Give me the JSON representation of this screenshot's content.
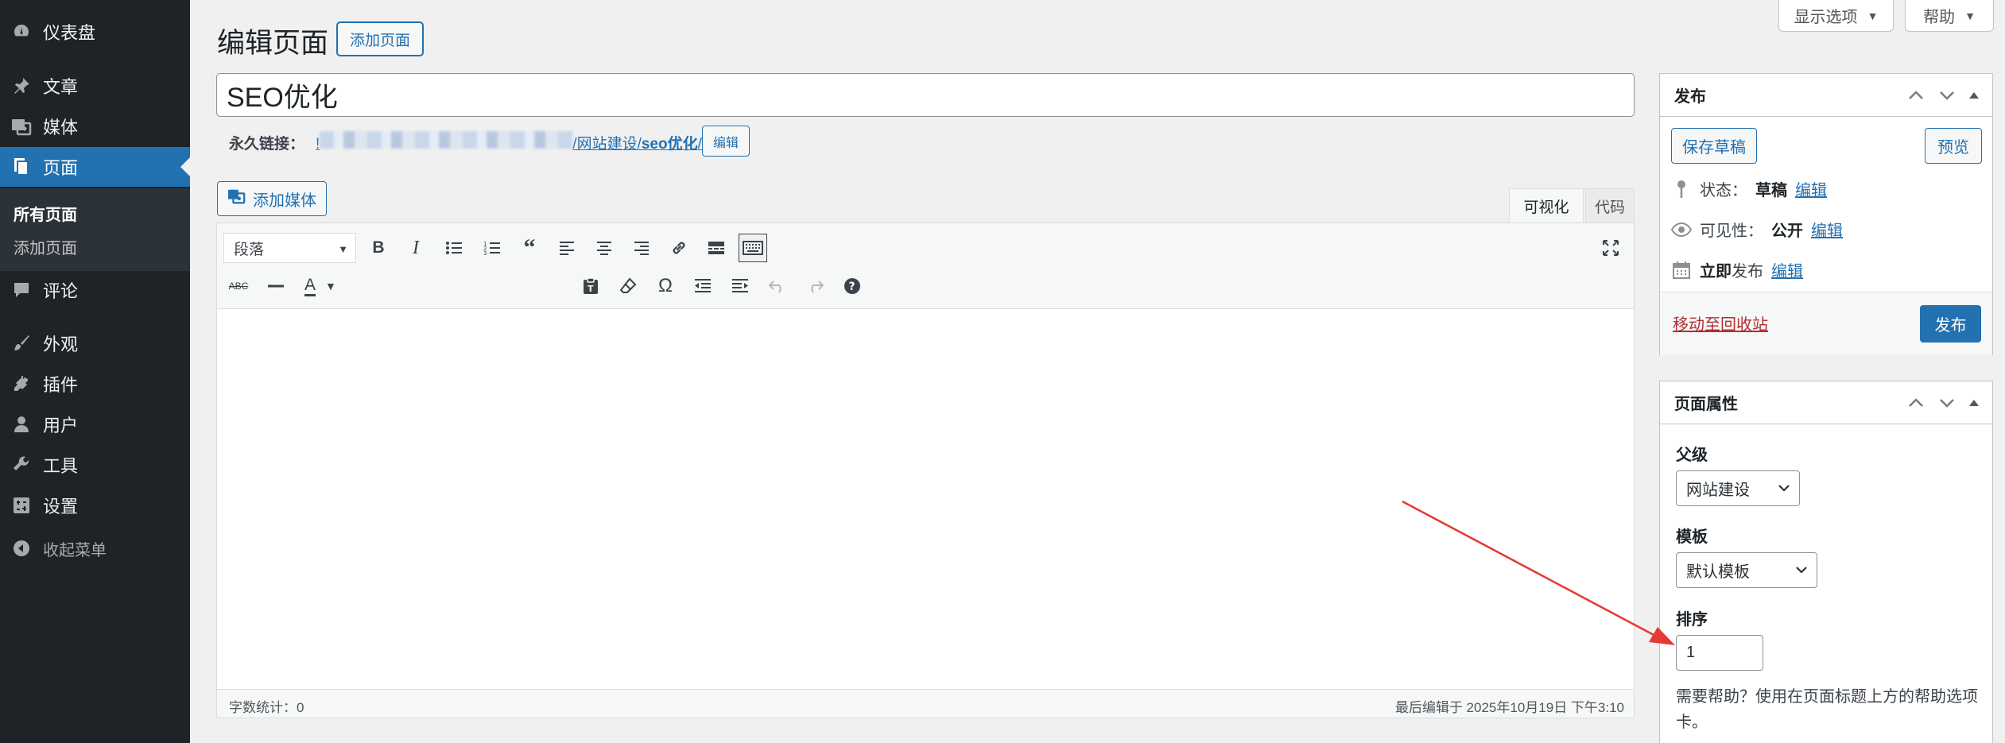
{
  "sidebar": {
    "items": [
      {
        "label": "仪表盘",
        "icon": "dashboard-icon"
      },
      {
        "label": "文章",
        "icon": "pin-icon"
      },
      {
        "label": "媒体",
        "icon": "media-icon"
      },
      {
        "label": "页面",
        "icon": "pages-icon"
      },
      {
        "label": "评论",
        "icon": "comment-icon"
      },
      {
        "label": "外观",
        "icon": "brush-icon"
      },
      {
        "label": "插件",
        "icon": "plugin-icon"
      },
      {
        "label": "用户",
        "icon": "user-icon"
      },
      {
        "label": "工具",
        "icon": "wrench-icon"
      },
      {
        "label": "设置",
        "icon": "settings-icon"
      },
      {
        "label": "收起菜单",
        "icon": "collapse-icon"
      }
    ],
    "submenu": [
      "所有页面",
      "添加页面"
    ]
  },
  "screen_options": {
    "label": "显示选项"
  },
  "help_tab": {
    "label": "帮助"
  },
  "heading": {
    "title": "编辑页面",
    "add_new": "添加页面"
  },
  "post_title": {
    "value": "SEO优化"
  },
  "permalink": {
    "label": "永久链接：",
    "first_char": "!",
    "path": "/网站建设/",
    "slug": "seo优化",
    "trailing": "/",
    "edit": "编辑"
  },
  "editor": {
    "add_media": "添加媒体",
    "tab_visual": "可视化",
    "tab_code": "代码",
    "format": "段落",
    "word_count": "字数统计：0",
    "last_edited": "最后编辑于 2025年10月19日 下午3:10"
  },
  "publish_box": {
    "title": "发布",
    "save_draft": "保存草稿",
    "preview": "预览",
    "status_label": "状态：",
    "status_value": "草稿",
    "visibility_label": "可见性：",
    "visibility_value": "公开",
    "schedule_prefix": "立即",
    "schedule_suffix": "发布",
    "edit": "编辑",
    "trash": "移动至回收站",
    "publish": "发布"
  },
  "attributes_box": {
    "title": "页面属性",
    "parent_label": "父级",
    "parent_value": "网站建设",
    "template_label": "模板",
    "template_value": "默认模板",
    "order_label": "排序",
    "order_value": "1",
    "help": "需要帮助？使用在页面标题上方的帮助选项卡。"
  },
  "colors": {
    "accent": "#2271b1",
    "sidebar": "#1d2327",
    "annotation": "#e53935"
  }
}
